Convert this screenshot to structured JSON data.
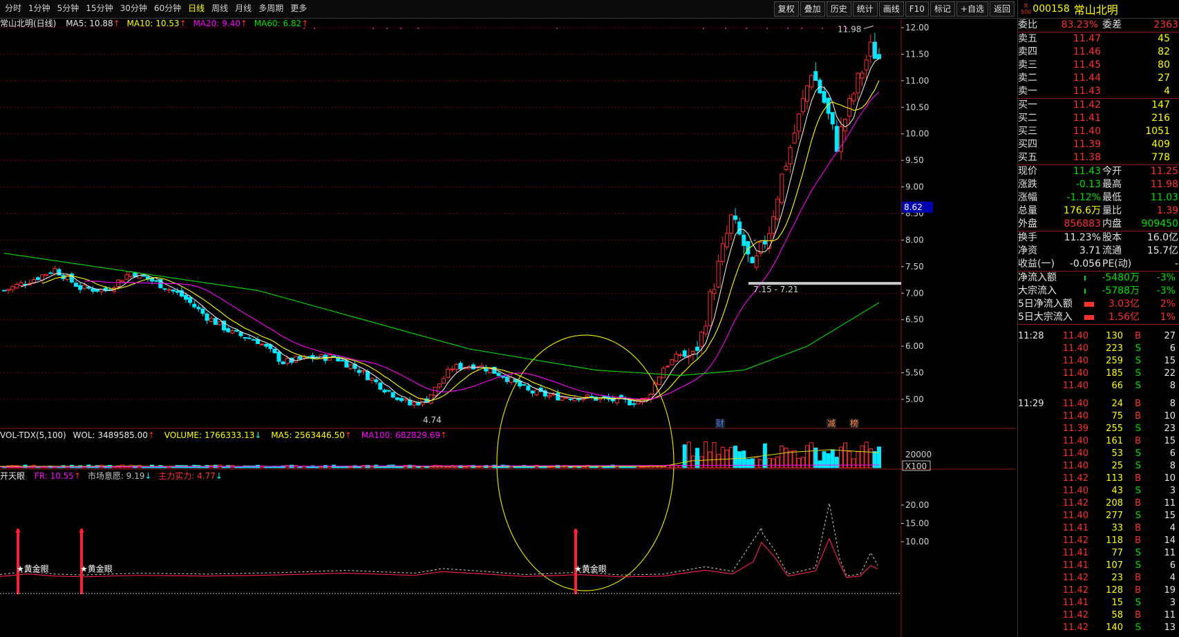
{
  "toolbar": {
    "periods": [
      "分时",
      "1分钟",
      "5分钟",
      "15分钟",
      "30分钟",
      "60分钟",
      "日线",
      "周线",
      "月线",
      "多周期",
      "更多"
    ],
    "active_period": "日线",
    "tools": [
      "复权",
      "叠加",
      "历史",
      "统计",
      "画线",
      "F10",
      "标记",
      "+自选",
      "返回"
    ]
  },
  "header": {
    "stock_title": "常山北明(日线)",
    "ma5": "MA5: 10.88",
    "ma10": "MA10: 10.53",
    "ma20": "MA20: 9.40",
    "ma60": "MA60: 6.82",
    "up_arrow": "↑",
    "down_arrow": "↓"
  },
  "price_axis": [
    "12.00",
    "11.50",
    "11.00",
    "10.50",
    "10.00",
    "9.50",
    "9.00",
    "8.50",
    "8.00",
    "7.50",
    "7.00",
    "6.50",
    "6.00",
    "5.50",
    "5.00"
  ],
  "price_marker": "8.62",
  "annotations": {
    "high_label": "11.98",
    "low_label": "4.74",
    "range_label": "7.15 - 7.21",
    "dash_mark": "-",
    "badge_cai": "财",
    "badge_jian": "减",
    "badge_bang": "榜",
    "gold_eye": "★黄金眼"
  },
  "volume": {
    "title": "VOL-TDX(5,100)",
    "wol": "WOL: 3489585.00",
    "volume": "VOLUME: 1766333.13",
    "ma5": "MA5: 2563446.50",
    "ma100": "MA100: 682829.69",
    "axis_label": "20000",
    "unit": "X100"
  },
  "indicator": {
    "title": "开天眼",
    "fr": "FR: 10.55",
    "sentiment": "市场意愿: 9.19",
    "force": "主力实力: 4.77",
    "axis": [
      "20.00",
      "15.00",
      "10.00"
    ]
  },
  "quote": {
    "badge_r": "R",
    "badge_500": "500",
    "code": "000158",
    "name": "常山北明",
    "weibi_label": "委比",
    "weibi": "83.23%",
    "weicha_label": "委差",
    "weicha": "2363",
    "asks": [
      {
        "label": "卖五",
        "price": "11.47",
        "vol": "45"
      },
      {
        "label": "卖四",
        "price": "11.46",
        "vol": "82"
      },
      {
        "label": "卖三",
        "price": "11.45",
        "vol": "80"
      },
      {
        "label": "卖二",
        "price": "11.44",
        "vol": "27"
      },
      {
        "label": "卖一",
        "price": "11.43",
        "vol": "4"
      }
    ],
    "bids": [
      {
        "label": "买一",
        "price": "11.42",
        "vol": "147"
      },
      {
        "label": "买二",
        "price": "11.41",
        "vol": "216"
      },
      {
        "label": "买三",
        "price": "11.40",
        "vol": "1051"
      },
      {
        "label": "买四",
        "price": "11.39",
        "vol": "409"
      },
      {
        "label": "买五",
        "price": "11.38",
        "vol": "778"
      }
    ],
    "stats": [
      {
        "l1": "现价",
        "v1": "11.43",
        "l2": "今开",
        "v2": "11.25",
        "c1": "green",
        "c2": "red"
      },
      {
        "l1": "涨跌",
        "v1": "-0.13",
        "l2": "最高",
        "v2": "11.98",
        "c1": "green",
        "c2": "red"
      },
      {
        "l1": "涨幅",
        "v1": "-1.12%",
        "l2": "最低",
        "v2": "11.03",
        "c1": "green",
        "c2": "green"
      },
      {
        "l1": "总量",
        "v1": "176.6万",
        "l2": "量比",
        "v2": "1.39",
        "c1": "yel",
        "c2": "red"
      },
      {
        "l1": "外盘",
        "v1": "856883",
        "l2": "内盘",
        "v2": "909450",
        "c1": "red",
        "c2": "green"
      }
    ],
    "stats2": [
      {
        "l1": "换手",
        "v1": "11.23%",
        "l2": "股本",
        "v2": "16.0亿",
        "c1": "white",
        "c2": "white"
      },
      {
        "l1": "净资",
        "v1": "3.71",
        "l2": "流通",
        "v2": "15.7亿",
        "c1": "white",
        "c2": "white"
      },
      {
        "l1": "收益(一)",
        "v1": "-0.056",
        "l2": "PE(动)",
        "v2": "-",
        "c1": "white",
        "c2": "white"
      }
    ],
    "flows": [
      {
        "label": "净流入额",
        "val": "-5480万",
        "pct": "-3%",
        "c": "green"
      },
      {
        "label": "大宗流入",
        "val": "-5788万",
        "pct": "-3%",
        "c": "green"
      },
      {
        "label": "5日净流入额",
        "val": "3.03亿",
        "pct": "2%",
        "c": "red"
      },
      {
        "label": "5日大宗流入",
        "val": "1.56亿",
        "pct": "1%",
        "c": "red"
      }
    ],
    "ticks": [
      {
        "t": "11:28",
        "p": "11.40",
        "v": "130",
        "s": "B",
        "n": "27"
      },
      {
        "t": "",
        "p": "11.40",
        "v": "223",
        "s": "S",
        "n": "6"
      },
      {
        "t": "",
        "p": "11.40",
        "v": "259",
        "s": "S",
        "n": "15"
      },
      {
        "t": "",
        "p": "11.40",
        "v": "185",
        "s": "S",
        "n": "22"
      },
      {
        "t": "",
        "p": "11.40",
        "v": "66",
        "s": "S",
        "n": "8"
      },
      {
        "t": "11:29",
        "p": "11.40",
        "v": "24",
        "s": "B",
        "n": "8"
      },
      {
        "t": "",
        "p": "11.40",
        "v": "75",
        "s": "B",
        "n": "10"
      },
      {
        "t": "",
        "p": "11.39",
        "v": "255",
        "s": "S",
        "n": "23"
      },
      {
        "t": "",
        "p": "11.40",
        "v": "161",
        "s": "B",
        "n": "15"
      },
      {
        "t": "",
        "p": "11.40",
        "v": "53",
        "s": "S",
        "n": "6"
      },
      {
        "t": "",
        "p": "11.40",
        "v": "25",
        "s": "S",
        "n": "8"
      },
      {
        "t": "",
        "p": "11.42",
        "v": "113",
        "s": "B",
        "n": "10"
      },
      {
        "t": "",
        "p": "11.40",
        "v": "43",
        "s": "S",
        "n": "3"
      },
      {
        "t": "",
        "p": "11.42",
        "v": "208",
        "s": "B",
        "n": "11"
      },
      {
        "t": "",
        "p": "11.40",
        "v": "277",
        "s": "S",
        "n": "15"
      },
      {
        "t": "",
        "p": "11.41",
        "v": "33",
        "s": "B",
        "n": "4"
      },
      {
        "t": "",
        "p": "11.42",
        "v": "118",
        "s": "B",
        "n": "14"
      },
      {
        "t": "",
        "p": "11.41",
        "v": "77",
        "s": "S",
        "n": "11"
      },
      {
        "t": "",
        "p": "11.41",
        "v": "107",
        "s": "S",
        "n": "6"
      },
      {
        "t": "",
        "p": "11.42",
        "v": "23",
        "s": "B",
        "n": "4"
      },
      {
        "t": "",
        "p": "11.42",
        "v": "128",
        "s": "B",
        "n": "19"
      },
      {
        "t": "",
        "p": "11.41",
        "v": "15",
        "s": "S",
        "n": "3"
      },
      {
        "t": "",
        "p": "11.42",
        "v": "58",
        "s": "B",
        "n": "11"
      },
      {
        "t": "",
        "p": "11.42",
        "v": "140",
        "s": "S",
        "n": "13"
      }
    ]
  },
  "colors": {
    "up": "#ff3030",
    "down": "#00e8ff",
    "ma5": "#e8e8e8",
    "ma10": "#ffff00",
    "ma20": "#ff00ff",
    "ma60": "#00e000",
    "grid": "#7a0000"
  }
}
